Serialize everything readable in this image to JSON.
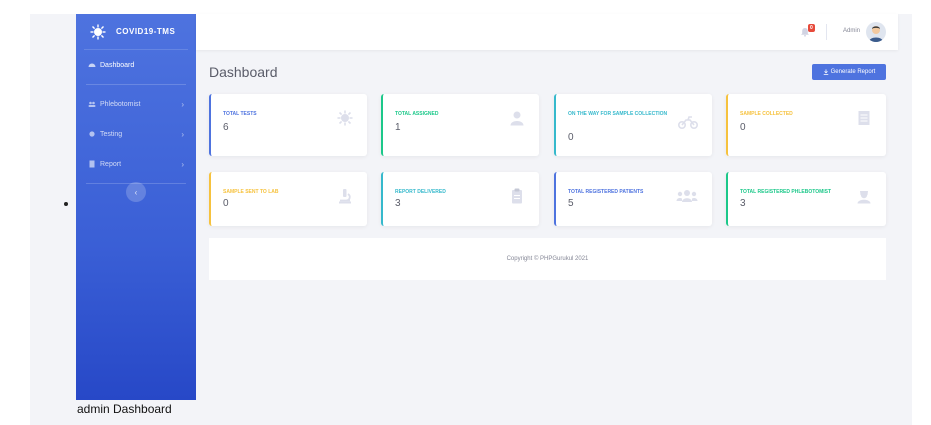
{
  "brand": {
    "name": "COVID19-TMS"
  },
  "sidebar": {
    "items": [
      {
        "label": "Dashboard"
      },
      {
        "label": "Phlebotomist"
      },
      {
        "label": "Testing"
      },
      {
        "label": "Report"
      }
    ],
    "toggle_glyph": "‹"
  },
  "topbar": {
    "notification_count": "0",
    "user_name": "Admin"
  },
  "main": {
    "title": "Dashboard",
    "generate_report_label": "Generate Report",
    "cards": [
      {
        "label": "TOTAL TESTS",
        "value": "6",
        "color": "#4e73df",
        "icon": "virus-icon"
      },
      {
        "label": "TOTAL ASSIGNED",
        "value": "1",
        "color": "#1cc88a",
        "icon": "user-icon"
      },
      {
        "label": "ON THE WAY FOR SAMPLE COLLECTION",
        "value": "0",
        "color": "#36b9cc",
        "icon": "motorcycle-icon"
      },
      {
        "label": "SAMPLE COLLECTED",
        "value": "0",
        "color": "#f6c23e",
        "icon": "file-icon"
      },
      {
        "label": "SAMPLE SENT TO LAB",
        "value": "0",
        "color": "#f6c23e",
        "icon": "microscope-icon"
      },
      {
        "label": "REPORT DELIVERED",
        "value": "3",
        "color": "#36b9cc",
        "icon": "clipboard-icon"
      },
      {
        "label": "TOTAL REGISTERED PATIENTS",
        "value": "5",
        "color": "#4e73df",
        "icon": "users-icon"
      },
      {
        "label": "TOTAL REGISTERED PHLEBOTOMIST",
        "value": "3",
        "color": "#1cc88a",
        "icon": "user-nurse-icon"
      }
    ]
  },
  "footer": {
    "copyright": "Copyright © PHPGurukul 2021"
  },
  "caption": "admin Dashboard"
}
